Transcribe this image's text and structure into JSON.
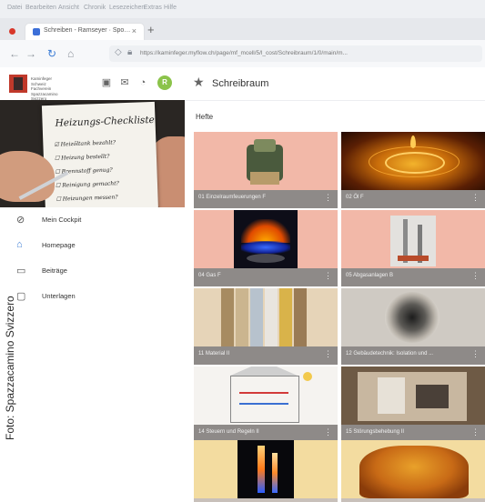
{
  "browser": {
    "menu_items": [
      "Datei",
      "Bearbeiten",
      "Ansicht",
      "Chronik",
      "Lesezeichen",
      "Extras",
      "Hilfe"
    ],
    "tab_title": "Schreiben - Ramseyer · Spo…",
    "tab_close": "×",
    "new_tab": "+",
    "url": "https://kaminfeger.myflow.ch/page/mf_mcell/5/l_cost/Schreibraum/1/0/main/m..."
  },
  "header": {
    "logo_text": "Kaminfeger Schweiz\nFachverein\nSpazzacamino Svizzero",
    "avatar_letter": "R",
    "page_title": "Schreibraum"
  },
  "hero": {
    "heading": "Heizungs-Checkliste",
    "lines": [
      "Heizöltank bezahlt?",
      "Heizung bestellt?",
      "Brennstoff genug?",
      "Reinigung gemacht?",
      "Heizungen messen?"
    ]
  },
  "sidebar": {
    "items": [
      {
        "label": "Mein Cockpit",
        "icon": "dashboard-icon",
        "active": false
      },
      {
        "label": "Homepage",
        "icon": "home-icon",
        "active": true
      },
      {
        "label": "Beiträge",
        "icon": "document-icon",
        "active": false
      },
      {
        "label": "Unterlagen",
        "icon": "folder-icon",
        "active": false
      }
    ]
  },
  "credit": "Foto: Spazzacamino Svizzero",
  "main": {
    "section_title": "Hefte",
    "more_icon": "⋮",
    "cards": [
      {
        "caption": "01 Einzelraumfeuerungen F",
        "theme": "pump"
      },
      {
        "caption": "02 Öl F",
        "theme": "oil"
      },
      {
        "caption": "04 Gas F",
        "theme": "gas"
      },
      {
        "caption": "05 Abgasanlagen B",
        "theme": "chimney"
      },
      {
        "caption": "11 Material II",
        "theme": "material"
      },
      {
        "caption": "12 Gebäudetechnik: Isolation und ...",
        "theme": "pipe"
      },
      {
        "caption": "14 Steuern und Regeln II",
        "theme": "diagram"
      },
      {
        "caption": "15 Störungsbehebung II",
        "theme": "panel"
      },
      {
        "caption": "",
        "theme": "flame2"
      },
      {
        "caption": "",
        "theme": "spice"
      }
    ]
  },
  "colors": {
    "accent_blue": "#3a7bd5",
    "card_pink": "#f2b8a8",
    "card_footer": "#8e8a88",
    "avatar_green": "#8bc34a",
    "logo_red": "#c0392b"
  }
}
